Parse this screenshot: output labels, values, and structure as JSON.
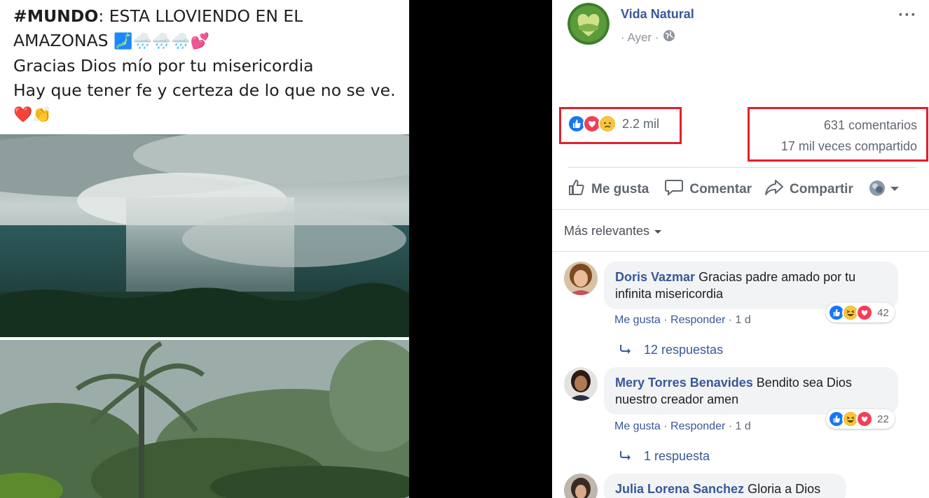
{
  "post": {
    "hashtag": "#MUNDO",
    "line1_rest": ": ESTA LLOVIENDO EN EL",
    "line2": "AMAZONAS",
    "line2_emojis": "🗾🌧️🌧️🌧️💕",
    "line3": "Gracias Dios mío por tu misericordia",
    "line4": "Hay que tener fe y certeza de lo que no se ve.",
    "line5_emojis": "❤️👏"
  },
  "page": {
    "name": "Vida Natural",
    "time": "· Ayer ·",
    "audience_icon": "globe-icon",
    "more": "···"
  },
  "reactions": {
    "icons": [
      "like-icon",
      "love-icon",
      "sad-icon"
    ],
    "count": "2.2 mil",
    "comments": "631 comentarios",
    "shares": "17 mil veces compartido",
    "highlight_color": "#e0202a"
  },
  "actions": {
    "like": "Me gusta",
    "comment": "Comentar",
    "share": "Compartir"
  },
  "sort": {
    "label": "Más relevantes"
  },
  "comments": [
    {
      "author": "Doris Vazmar",
      "text": " Gracias padre amado por tu infinita misericordia",
      "reaction_count": "42",
      "like": "Me gusta",
      "reply": "Responder",
      "time": "1 d",
      "replies": "12 respuestas"
    },
    {
      "author": "Mery Torres Benavides",
      "text": " Bendito sea Dios nuestro creador amen",
      "reaction_count": "22",
      "like": "Me gusta",
      "reply": "Responder",
      "time": "1 d",
      "replies": "1 respuesta"
    },
    {
      "author": "Julia Lorena Sanchez",
      "text": " Gloria a Dios"
    }
  ],
  "colors": {
    "link": "#385898",
    "like_blue": "#1877f2",
    "love_red": "#f33e58",
    "haha_yellow": "#f7b125"
  }
}
